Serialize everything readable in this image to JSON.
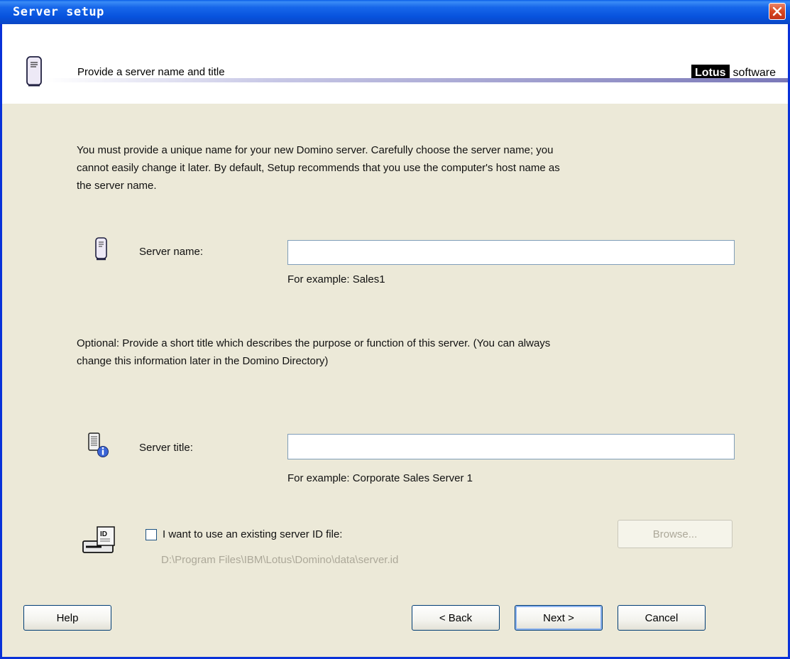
{
  "window": {
    "title": "Server setup"
  },
  "header": {
    "title": "Provide a server name and title",
    "logo_brand": "Lotus",
    "logo_text": "software"
  },
  "intro": {
    "line1": "You must provide a unique name for your new Domino server. Carefully choose the server name; you",
    "line2": "cannot easily change it later. By default, Setup recommends that you use the computer's host name as",
    "line3": "the server name."
  },
  "server_name": {
    "label": "Server name:",
    "value": "",
    "hint": "For example: Sales1"
  },
  "optional": {
    "line1": "Optional: Provide a short title which describes the purpose or function of this server. (You can always",
    "line2": "change this information later in the Domino Directory)"
  },
  "server_title": {
    "label": "Server title:",
    "value": "",
    "hint": "For example: Corporate Sales Server 1"
  },
  "id_file": {
    "checkbox_label": "I want to use an existing server ID file:",
    "checked": false,
    "path": "D:\\Program Files\\IBM\\Lotus\\Domino\\data\\server.id",
    "browse_label": "Browse..."
  },
  "buttons": {
    "help": "Help",
    "back": "< Back",
    "next": "Next >",
    "cancel": "Cancel"
  },
  "colors": {
    "titlebar": "#0752dd",
    "dialog_bg": "#ece9d8",
    "close": "#d8481f"
  }
}
